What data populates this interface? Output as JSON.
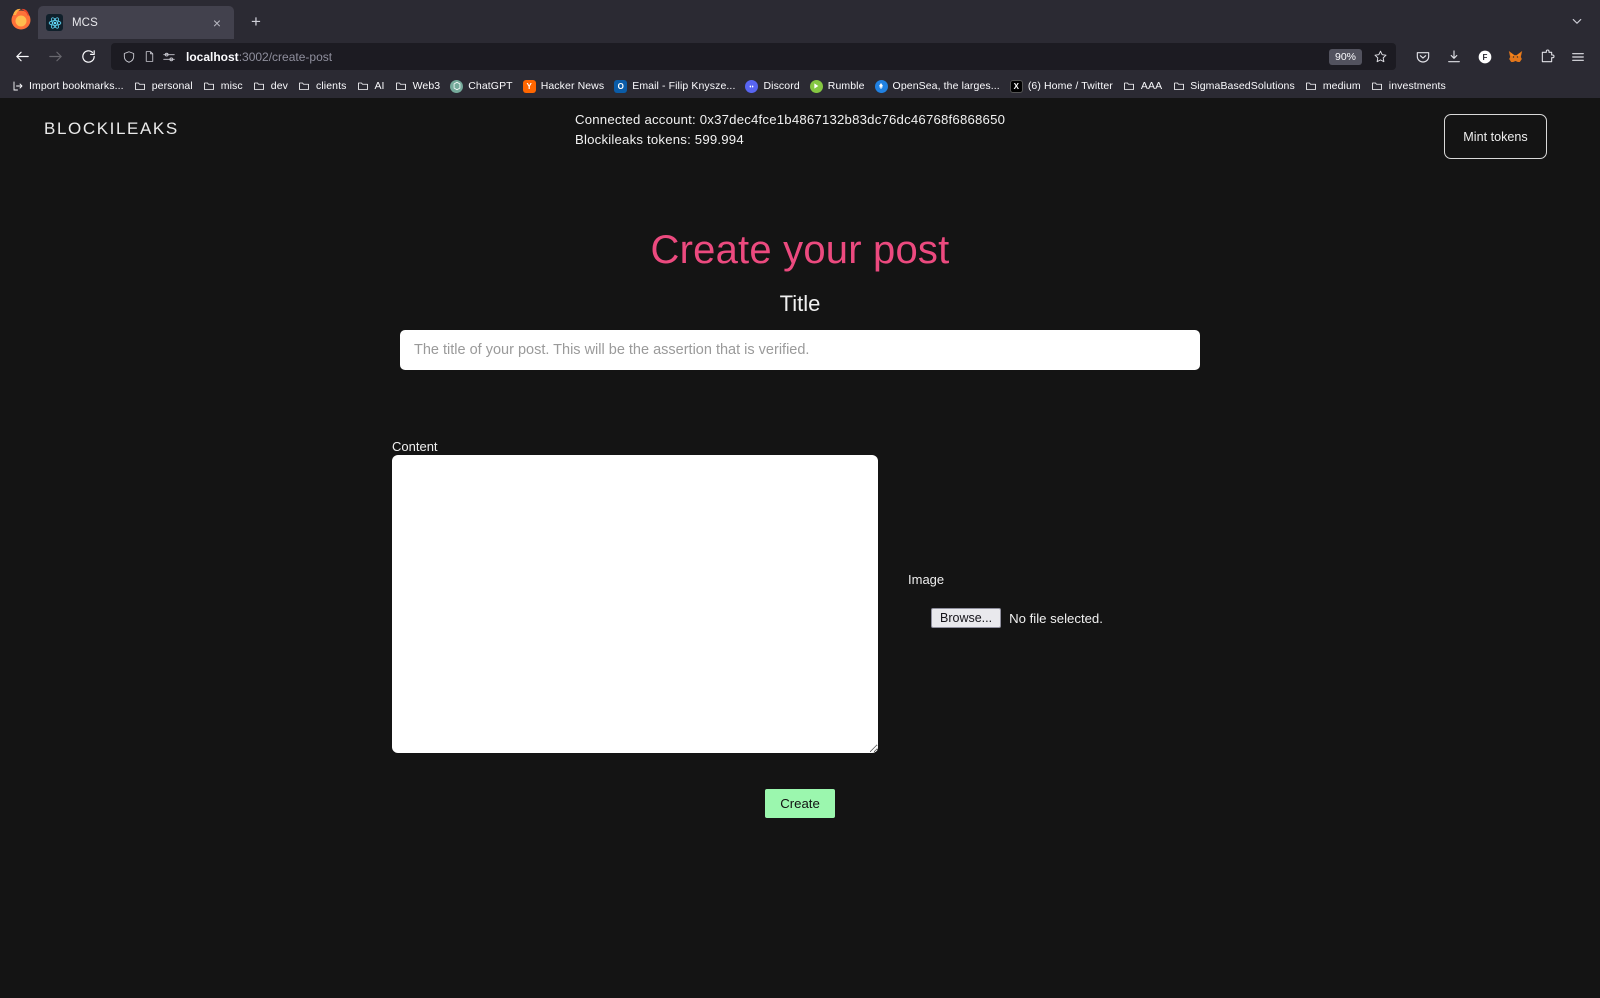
{
  "browser": {
    "tab": {
      "title": "MCS",
      "favicon": "react-atom-icon",
      "close_label": "×"
    },
    "newtab_label": "+",
    "nav": {
      "back": "←",
      "forward": "→",
      "reload": "↻"
    },
    "url": {
      "host": "localhost",
      "rest": ":3002/create-post",
      "full": "localhost:3002/create-post"
    },
    "zoom_level": "90%",
    "toolbar_icons": [
      "pocket-icon",
      "downloads-icon",
      "firefox-account-icon",
      "metamask-icon",
      "extensions-icon",
      "app-menu-icon"
    ],
    "bookmarks": [
      {
        "label": "Import bookmarks...",
        "icon": "import-icon"
      },
      {
        "label": "personal",
        "icon": "folder-icon"
      },
      {
        "label": "misc",
        "icon": "folder-icon"
      },
      {
        "label": "dev",
        "icon": "folder-icon"
      },
      {
        "label": "clients",
        "icon": "folder-icon"
      },
      {
        "label": "AI",
        "icon": "folder-icon"
      },
      {
        "label": "Web3",
        "icon": "folder-icon"
      },
      {
        "label": "ChatGPT",
        "icon": "chatgpt-icon"
      },
      {
        "label": "Hacker News",
        "icon": "hackernews-icon"
      },
      {
        "label": "Email - Filip Knysze...",
        "icon": "outlook-icon"
      },
      {
        "label": "Discord",
        "icon": "discord-icon"
      },
      {
        "label": "Rumble",
        "icon": "rumble-icon"
      },
      {
        "label": "OpenSea, the larges...",
        "icon": "opensea-icon"
      },
      {
        "label": "(6) Home / Twitter",
        "icon": "twitter-x-icon"
      },
      {
        "label": "AAA",
        "icon": "folder-icon"
      },
      {
        "label": "SigmaBasedSolutions",
        "icon": "folder-icon"
      },
      {
        "label": "medium",
        "icon": "folder-icon"
      },
      {
        "label": "investments",
        "icon": "folder-icon"
      }
    ]
  },
  "site": {
    "brand": "BLOCKILEAKS",
    "connected_account_line": "Connected account: 0x37dec4fce1b4867132b83dc76dc46768f6868650",
    "tokens_line": "Blockileaks tokens: 599.994",
    "mint_button": "Mint tokens"
  },
  "form": {
    "heading": "Create your post",
    "title_label": "Title",
    "title_value": "",
    "title_placeholder": "The title of your post. This will be the assertion that is verified.",
    "content_label": "Content",
    "content_value": "",
    "image_label": "Image",
    "browse_button": "Browse...",
    "file_status": "No file selected.",
    "submit_button": "Create"
  },
  "colors": {
    "page_background": "#141414",
    "heading_pink": "#ec4a7f",
    "submit_green": "#9bf7ae",
    "chrome_background": "#2b2a33",
    "urlbar_background": "#1c1b22"
  }
}
